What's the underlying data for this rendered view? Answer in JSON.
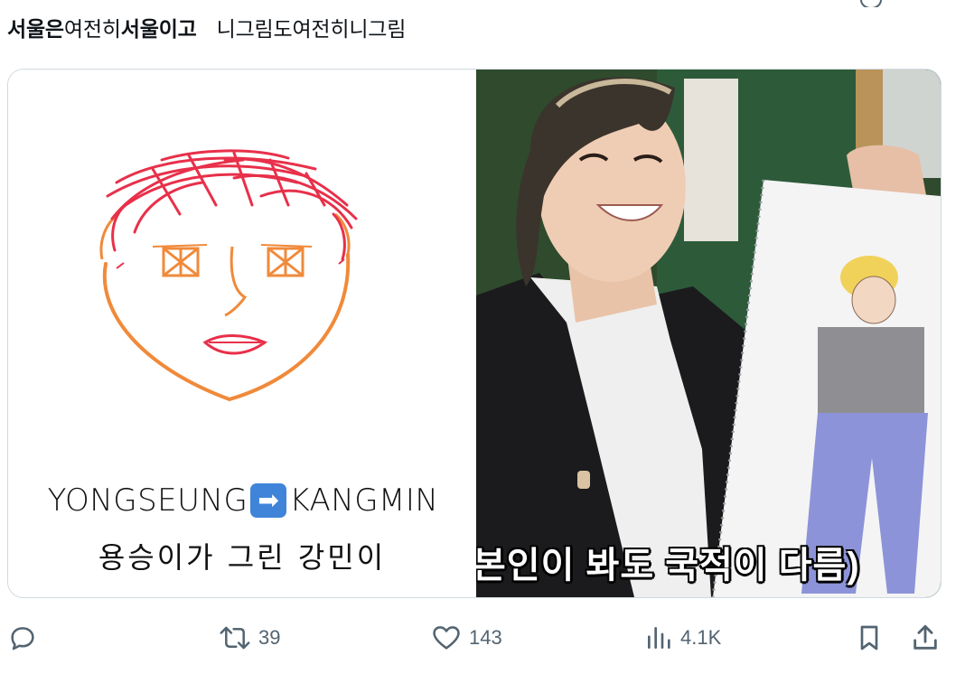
{
  "tweet": {
    "text_segments": [
      {
        "text": "서울은",
        "bold": true
      },
      {
        "text": "여전히",
        "bold": false
      },
      {
        "text": "서울이고",
        "bold": true
      },
      {
        "text": "니그림도여전히니그림",
        "bold": false
      }
    ]
  },
  "media": {
    "left": {
      "caption_en_from": "YONGSEUNG",
      "caption_en_to": "KANGMIN",
      "arrow_emoji": "➡",
      "caption_ko": "용승이가 그린 강민이"
    },
    "right": {
      "subtitle": "본인이 봐도 국적이 다름)"
    }
  },
  "actions": {
    "reply": {
      "icon": "reply-icon",
      "count": ""
    },
    "retweet": {
      "icon": "retweet-icon",
      "count": "39"
    },
    "like": {
      "icon": "heart-icon",
      "count": "143"
    },
    "views": {
      "icon": "views-chart-icon",
      "count": "4.1K"
    },
    "bookmark": {
      "icon": "bookmark-icon"
    },
    "share": {
      "icon": "share-icon"
    }
  },
  "colors": {
    "text": "#0f1419",
    "muted": "#536471",
    "border": "#cfd9de",
    "red_hair": "#e8304a",
    "orange_face": "#f08a3a"
  }
}
